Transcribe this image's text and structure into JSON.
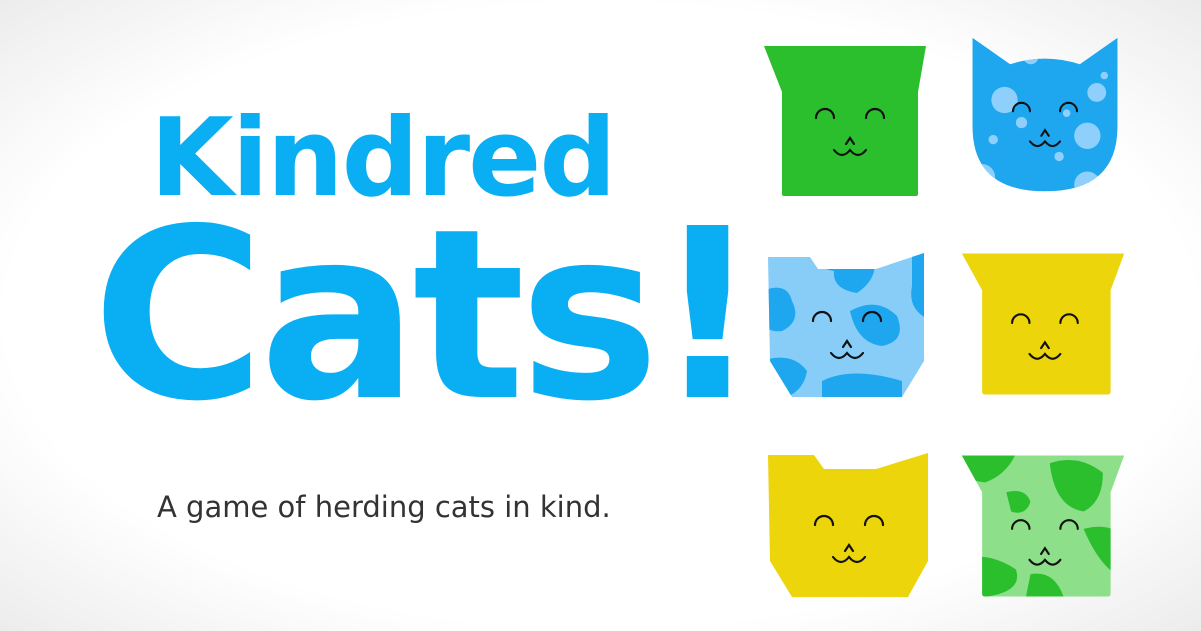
{
  "title": {
    "line1": "Kindred",
    "line2": "Cats!",
    "color": "#0aaef2"
  },
  "tagline": "A game of herding cats in kind.",
  "cats": [
    {
      "name": "green-square-cat",
      "shape": "square-ears",
      "color": "#2bbf2e",
      "pattern": "solid"
    },
    {
      "name": "blue-spotted-cat",
      "shape": "round-ears",
      "color": "#1ea6ee",
      "pattern": "spots",
      "pattern_color": "#8ed0fb"
    },
    {
      "name": "blue-patched-cat",
      "shape": "octagon-ears",
      "color": "#87cdf8",
      "pattern": "patches",
      "pattern_color": "#1ea6ee"
    },
    {
      "name": "yellow-square-cat",
      "shape": "square-ears",
      "color": "#ecd50a",
      "pattern": "solid"
    },
    {
      "name": "yellow-octagon-cat",
      "shape": "octagon-ears",
      "color": "#ecd50a",
      "pattern": "solid"
    },
    {
      "name": "green-patched-cat",
      "shape": "square-ears",
      "color": "#8ddf8a",
      "pattern": "patches",
      "pattern_color": "#2bbf2e"
    }
  ]
}
